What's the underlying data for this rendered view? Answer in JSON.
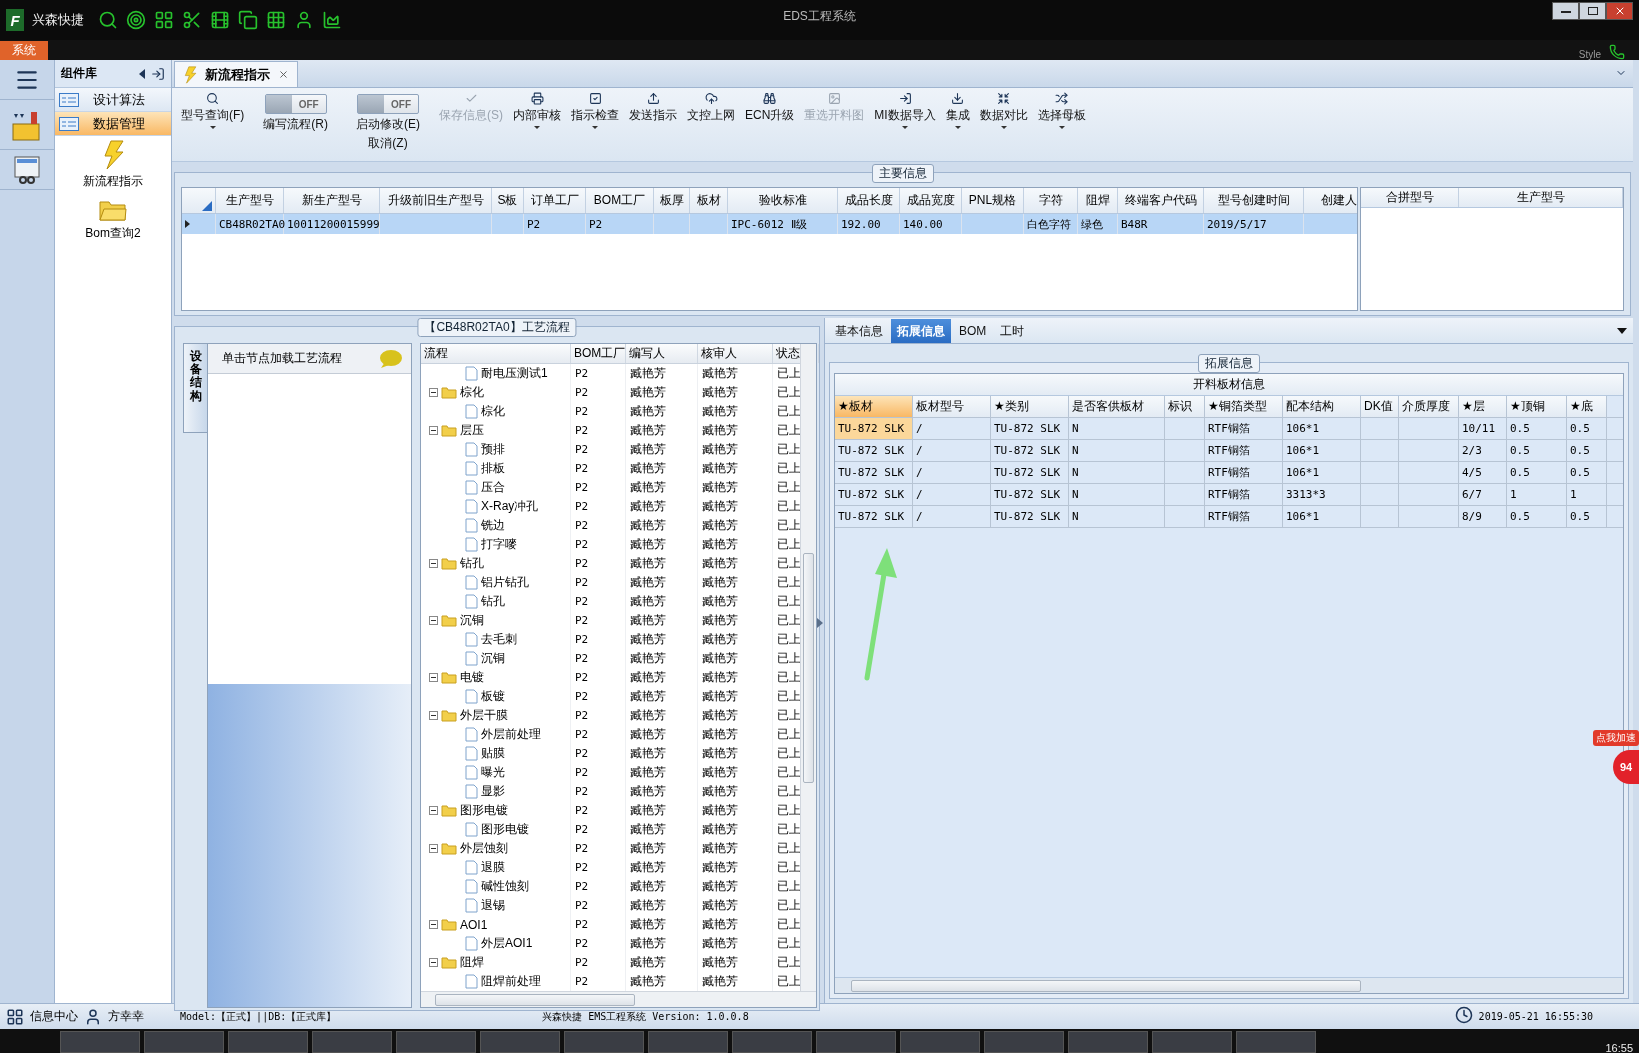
{
  "title_bar": {
    "logo": "F",
    "app_name": "兴森快捷",
    "title": "EDS工程系统"
  },
  "menu_bar": {
    "tab": "系统",
    "style_label": "Style"
  },
  "component_panel": {
    "title": "组件库",
    "groups": [
      {
        "label": "设计算法",
        "selected": false
      },
      {
        "label": "数据管理",
        "selected": true
      }
    ],
    "items": [
      {
        "label": "新流程指示",
        "kind": "lightning"
      },
      {
        "label": "Bom查询2",
        "kind": "folder"
      }
    ]
  },
  "doc_tabs": [
    {
      "label": "新流程指示",
      "selected": true
    }
  ],
  "toolbar": [
    {
      "kind": "button",
      "label": "型号查询(F)",
      "dropdown": true,
      "disabled": false
    },
    {
      "kind": "toggle",
      "label": "编写流程(R)",
      "on": false,
      "state_text": "OFF"
    },
    {
      "kind": "toggle",
      "label": "启动修改(E)",
      "sub_label": "取消(Z)",
      "on": false,
      "state_text": "OFF"
    },
    {
      "kind": "button",
      "label": "保存信息(S)",
      "dropdown": false,
      "disabled": true
    },
    {
      "kind": "button",
      "label": "内部审核",
      "dropdown": true,
      "disabled": false
    },
    {
      "kind": "button",
      "label": "指示检查",
      "dropdown": true,
      "disabled": false
    },
    {
      "kind": "button",
      "label": "发送指示",
      "dropdown": false,
      "disabled": false
    },
    {
      "kind": "button",
      "label": "文控上网",
      "dropdown": false,
      "disabled": false
    },
    {
      "kind": "button",
      "label": "ECN升级",
      "dropdown": false,
      "disabled": false
    },
    {
      "kind": "button",
      "label": "重选开料图",
      "dropdown": false,
      "disabled": true
    },
    {
      "kind": "button",
      "label": "MI数据导入",
      "dropdown": true,
      "disabled": false
    },
    {
      "kind": "button",
      "label": "集成",
      "dropdown": true,
      "disabled": false
    },
    {
      "kind": "button",
      "label": "数据对比",
      "dropdown": true,
      "disabled": false
    },
    {
      "kind": "button",
      "label": "选择母板",
      "dropdown": true,
      "disabled": false
    }
  ],
  "main_info": {
    "title": "主要信息",
    "columns": [
      {
        "label": "生产型号"
      },
      {
        "label": "新生产型号"
      },
      {
        "label": "升级前旧生产型号"
      },
      {
        "label": "S板"
      },
      {
        "label": "订单工厂"
      },
      {
        "label": "BOM工厂"
      },
      {
        "label": "板厚"
      },
      {
        "label": "板材"
      },
      {
        "label": "验收标准"
      },
      {
        "label": "成品长度"
      },
      {
        "label": "成品宽度"
      },
      {
        "label": "PNL规格"
      },
      {
        "label": "字符"
      },
      {
        "label": "阻焊"
      },
      {
        "label": "终端客户代码"
      },
      {
        "label": "型号创建时间"
      },
      {
        "label": "创建人"
      }
    ],
    "rows": [
      {
        "selected": true,
        "cells": [
          "CB48R02TA0",
          "10011200015999",
          null,
          null,
          "P2",
          "P2",
          null,
          null,
          "IPC-6012 Ⅱ级",
          "192.00",
          "140.00",
          null,
          "白色字符",
          "绿色",
          "B48R",
          "2019/5/17",
          null
        ]
      }
    ],
    "side_columns": [
      "合拼型号",
      "生产型号"
    ]
  },
  "process": {
    "title": "【CB48R02TA0】工艺流程",
    "side_tab": "设备结构",
    "hint": "单击节点加载工艺流程",
    "columns": [
      "流程",
      "BOM工厂",
      "编写人",
      "核审人",
      "状态"
    ],
    "nodes": [
      {
        "children": [
          {
            "label": "耐电压测试1",
            "bom": "P2",
            "writer": "臧艳芳",
            "reviewer": "臧艳芳",
            "status": "已上"
          }
        ]
      },
      {
        "label": "棕化",
        "expanded": true,
        "bom": "P2",
        "writer": "臧艳芳",
        "reviewer": "臧艳芳",
        "status": "已上",
        "children": [
          {
            "label": "棕化",
            "bom": "P2",
            "writer": "臧艳芳",
            "reviewer": "臧艳芳",
            "status": "已上"
          }
        ]
      },
      {
        "label": "层压",
        "expanded": true,
        "bom": "P2",
        "writer": "臧艳芳",
        "reviewer": "臧艳芳",
        "status": "已上",
        "children": [
          {
            "label": "预排",
            "bom": "P2",
            "writer": "臧艳芳",
            "reviewer": "臧艳芳",
            "status": "已上"
          },
          {
            "label": "排板",
            "bom": "P2",
            "writer": "臧艳芳",
            "reviewer": "臧艳芳",
            "status": "已上"
          },
          {
            "label": "压合",
            "bom": "P2",
            "writer": "臧艳芳",
            "reviewer": "臧艳芳",
            "status": "已上"
          },
          {
            "label": "X-Ray冲孔",
            "bom": "P2",
            "writer": "臧艳芳",
            "reviewer": "臧艳芳",
            "status": "已上"
          },
          {
            "label": "铣边",
            "bom": "P2",
            "writer": "臧艳芳",
            "reviewer": "臧艳芳",
            "status": "已上"
          },
          {
            "label": "打字嘜",
            "bom": "P2",
            "writer": "臧艳芳",
            "reviewer": "臧艳芳",
            "status": "已上"
          }
        ]
      },
      {
        "label": "钻孔",
        "expanded": true,
        "bom": "P2",
        "writer": "臧艳芳",
        "reviewer": "臧艳芳",
        "status": "已上",
        "children": [
          {
            "label": "铝片钻孔",
            "bom": "P2",
            "writer": "臧艳芳",
            "reviewer": "臧艳芳",
            "status": "已上"
          },
          {
            "label": "钻孔",
            "bom": "P2",
            "writer": "臧艳芳",
            "reviewer": "臧艳芳",
            "status": "已上"
          }
        ]
      },
      {
        "label": "沉铜",
        "expanded": true,
        "bom": "P2",
        "writer": "臧艳芳",
        "reviewer": "臧艳芳",
        "status": "已上",
        "children": [
          {
            "label": "去毛刺",
            "bom": "P2",
            "writer": "臧艳芳",
            "reviewer": "臧艳芳",
            "status": "已上"
          },
          {
            "label": "沉铜",
            "bom": "P2",
            "writer": "臧艳芳",
            "reviewer": "臧艳芳",
            "status": "已上"
          }
        ]
      },
      {
        "label": "电镀",
        "expanded": true,
        "bom": "P2",
        "writer": "臧艳芳",
        "reviewer": "臧艳芳",
        "status": "已上",
        "children": [
          {
            "label": "板镀",
            "bom": "P2",
            "writer": "臧艳芳",
            "reviewer": "臧艳芳",
            "status": "已上"
          }
        ]
      },
      {
        "label": "外层干膜",
        "expanded": true,
        "bom": "P2",
        "writer": "臧艳芳",
        "reviewer": "臧艳芳",
        "status": "已上",
        "children": [
          {
            "label": "外层前处理",
            "bom": "P2",
            "writer": "臧艳芳",
            "reviewer": "臧艳芳",
            "status": "已上"
          },
          {
            "label": "贴膜",
            "bom": "P2",
            "writer": "臧艳芳",
            "reviewer": "臧艳芳",
            "status": "已上"
          },
          {
            "label": "曝光",
            "bom": "P2",
            "writer": "臧艳芳",
            "reviewer": "臧艳芳",
            "status": "已上"
          },
          {
            "label": "显影",
            "bom": "P2",
            "writer": "臧艳芳",
            "reviewer": "臧艳芳",
            "status": "已上"
          }
        ]
      },
      {
        "label": "图形电镀",
        "expanded": true,
        "bom": "P2",
        "writer": "臧艳芳",
        "reviewer": "臧艳芳",
        "status": "已上",
        "children": [
          {
            "label": "图形电镀",
            "bom": "P2",
            "writer": "臧艳芳",
            "reviewer": "臧艳芳",
            "status": "已上"
          }
        ]
      },
      {
        "label": "外层蚀刻",
        "expanded": true,
        "bom": "P2",
        "writer": "臧艳芳",
        "reviewer": "臧艳芳",
        "status": "已上",
        "children": [
          {
            "label": "退膜",
            "bom": "P2",
            "writer": "臧艳芳",
            "reviewer": "臧艳芳",
            "status": "已上"
          },
          {
            "label": "碱性蚀刻",
            "bom": "P2",
            "writer": "臧艳芳",
            "reviewer": "臧艳芳",
            "status": "已上"
          },
          {
            "label": "退锡",
            "bom": "P2",
            "writer": "臧艳芳",
            "reviewer": "臧艳芳",
            "status": "已上"
          }
        ]
      },
      {
        "label": "AOI1",
        "expanded": true,
        "bom": "P2",
        "writer": "臧艳芳",
        "reviewer": "臧艳芳",
        "status": "已上",
        "children": [
          {
            "label": "外层AOI1",
            "bom": "P2",
            "writer": "臧艳芳",
            "reviewer": "臧艳芳",
            "status": "已上"
          }
        ]
      },
      {
        "label": "阻焊",
        "expanded": true,
        "bom": "P2",
        "writer": "臧艳芳",
        "reviewer": "臧艳芳",
        "status": "已上",
        "children": [
          {
            "label": "阻焊前处理",
            "bom": "P2",
            "writer": "臧艳芳",
            "reviewer": "臧艳芳",
            "status": "已上"
          }
        ]
      }
    ]
  },
  "detail": {
    "tabs": [
      {
        "label": "基本信息",
        "selected": false
      },
      {
        "label": "拓展信息",
        "selected": true
      },
      {
        "label": "BOM",
        "selected": false
      },
      {
        "label": "工时",
        "selected": false
      }
    ],
    "group_title": "拓展信息",
    "table": {
      "title": "开料板材信息",
      "columns": [
        "★板材",
        "板材型号",
        "★类别",
        "是否客供板材",
        "标识",
        "★铜箔类型",
        "配本结构",
        "DK值",
        "介质厚度",
        "★层",
        "★顶铜",
        "★底"
      ],
      "rows": [
        {
          "selected": true,
          "cells": [
            "TU-872 SLK",
            "/",
            "TU-872 SLK",
            "N",
            null,
            "RTF铜箔",
            "106*1",
            null,
            null,
            "10/11",
            "0.5",
            "0.5"
          ]
        },
        {
          "selected": false,
          "cells": [
            "TU-872 SLK",
            "/",
            "TU-872 SLK",
            "N",
            null,
            "RTF铜箔",
            "106*1",
            null,
            null,
            "2/3",
            "0.5",
            "0.5"
          ]
        },
        {
          "selected": false,
          "cells": [
            "TU-872 SLK",
            "/",
            "TU-872 SLK",
            "N",
            null,
            "RTF铜箔",
            "106*1",
            null,
            null,
            "4/5",
            "0.5",
            "0.5"
          ]
        },
        {
          "selected": false,
          "cells": [
            "TU-872 SLK",
            "/",
            "TU-872 SLK",
            "N",
            null,
            "RTF铜箔",
            "3313*3",
            null,
            null,
            "6/7",
            "1",
            "1"
          ]
        },
        {
          "selected": false,
          "cells": [
            "TU-872 SLK",
            "/",
            "TU-872 SLK",
            "N",
            null,
            "RTF铜箔",
            "106*1",
            null,
            null,
            "8/9",
            "0.5",
            "0.5"
          ]
        }
      ]
    }
  },
  "speed_widget": {
    "label": "点我加速",
    "count": "94"
  },
  "status_bar": {
    "info_center": "信息中心",
    "user": "方幸幸",
    "db_info": "Model:【正式】||DB:【正式库】",
    "version": "兴森快捷 EMS工程系统 Version: 1.0.0.8",
    "datetime": "2019-05-21 16:55:30"
  },
  "taskbar": {
    "clock": "16:55"
  }
}
